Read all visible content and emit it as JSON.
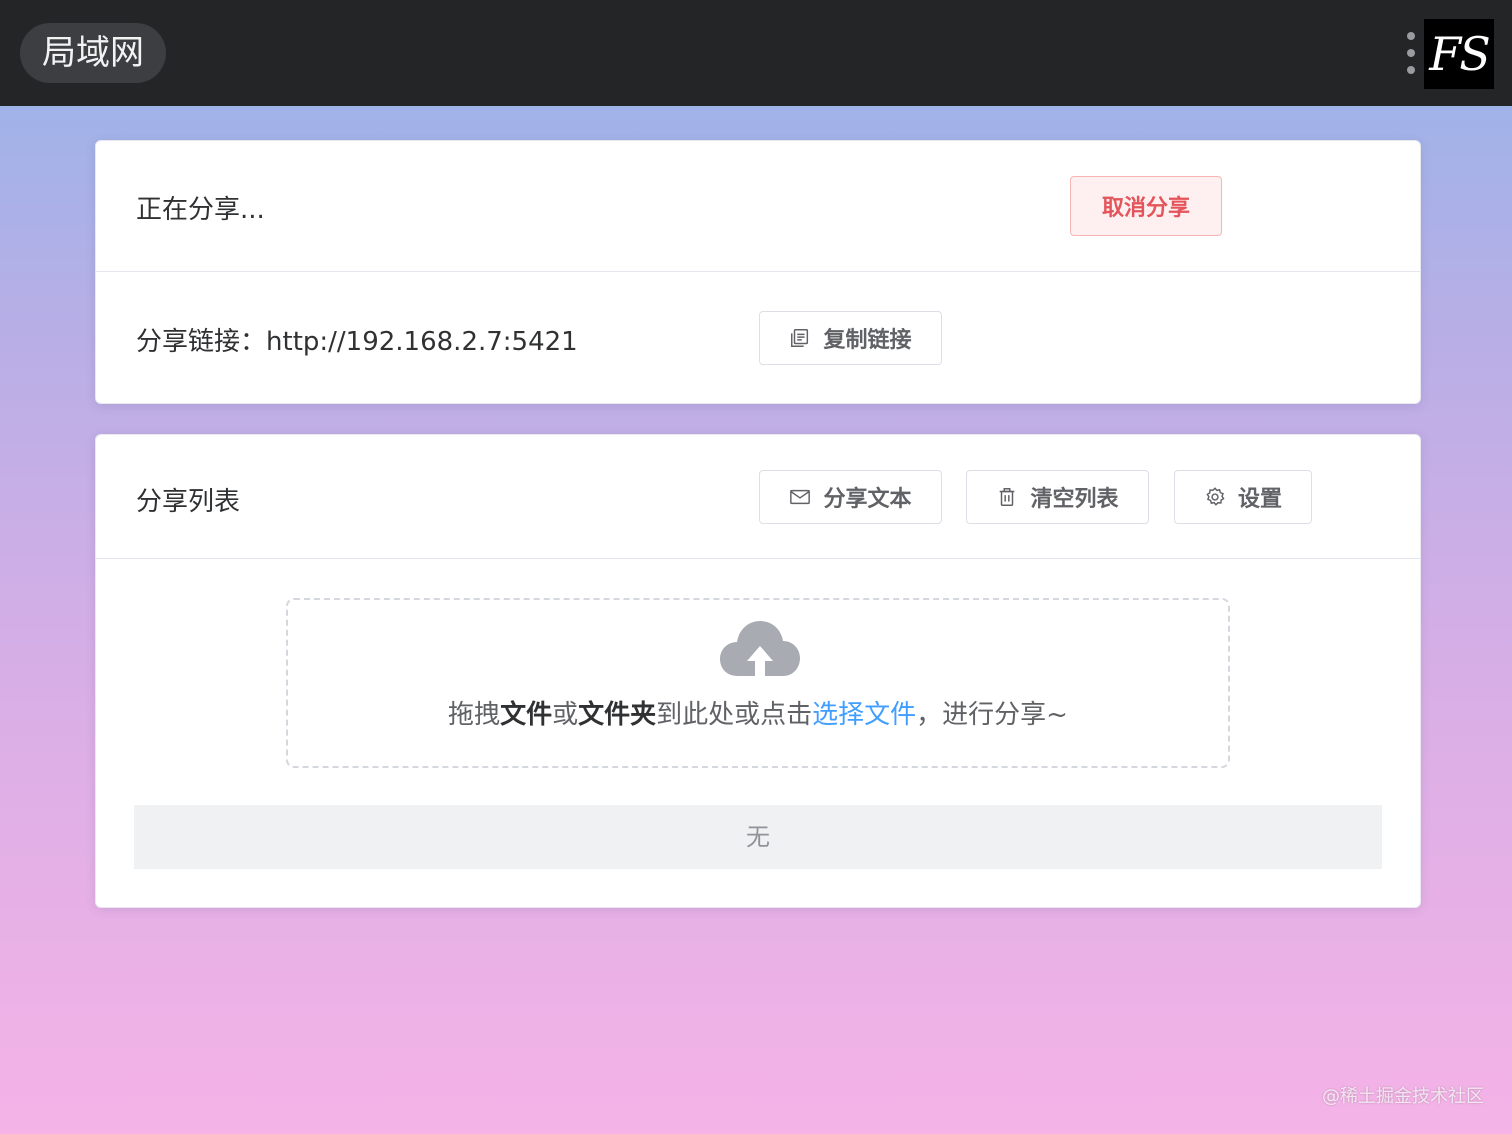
{
  "header": {
    "brand": "局域网",
    "logo_text": "FS",
    "menu_icon": "more-vertical-icon"
  },
  "share_status": {
    "status_text": "正在分享...",
    "cancel_button": "取消分享"
  },
  "share_link": {
    "label": "分享链接：",
    "url": "http://192.168.2.7:5421",
    "copy_button": "复制链接",
    "copy_icon": "copy-icon"
  },
  "share_list": {
    "title": "分享列表",
    "buttons": {
      "share_text": "分享文本",
      "clear_list": "清空列表",
      "settings": "设置"
    },
    "icons": {
      "share_text": "envelope-icon",
      "clear_list": "trash-icon",
      "settings": "gear-icon"
    },
    "upload": {
      "icon": "cloud-upload-icon",
      "text_1": "拖拽",
      "text_2": "文件",
      "text_3": "或",
      "text_4": "文件夹",
      "text_5": "到此处或点击",
      "link": "选择文件",
      "text_6": "，进行分享~"
    },
    "empty_text": "无"
  },
  "watermark": "@稀土掘金技术社区",
  "colors": {
    "topbar": "#242527",
    "danger": "#e4545a",
    "link": "#409eff"
  }
}
